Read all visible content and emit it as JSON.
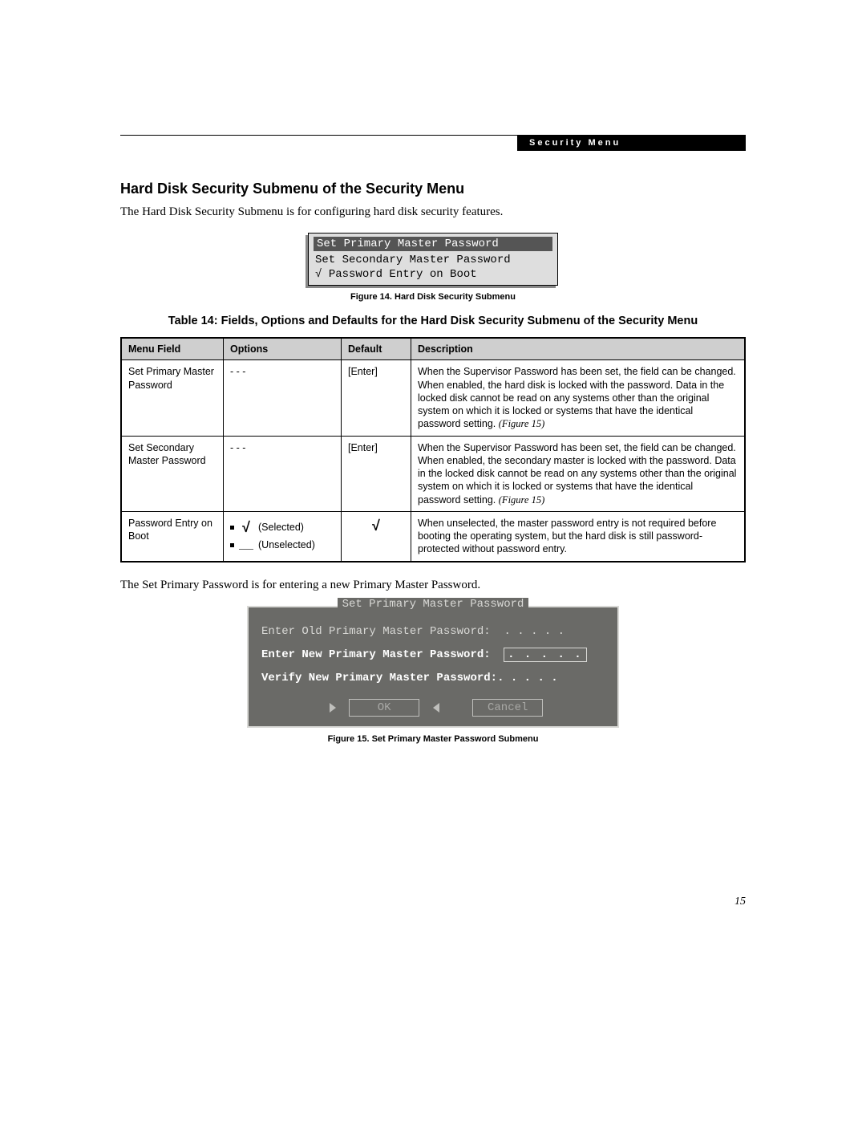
{
  "header_tag": "Security Menu",
  "section_title": "Hard Disk Security Submenu of the Security Menu",
  "intro_paragraph": "The Hard Disk Security Submenu is for configuring hard disk security features.",
  "fig14": {
    "rows": [
      "Set Primary Master Password",
      "Set Secondary Master Password",
      "Password Entry on Boot"
    ],
    "caption": "Figure 14.   Hard Disk Security Submenu"
  },
  "table": {
    "title": "Table 14: Fields, Options and Defaults for the Hard Disk Security Submenu of the Security Menu",
    "headers": {
      "c1": "Menu Field",
      "c2": "Options",
      "c3": "Default",
      "c4": "Description"
    },
    "rows": [
      {
        "field": "Set Primary Master Password",
        "options_text": "- - -",
        "default": "[Enter]",
        "description": "When the Supervisor Password has been set, the field can be changed. When enabled, the hard disk is locked with the password. Data in the locked disk cannot be read on any systems other than the original system on which it is locked or systems that have the identical password setting.",
        "figref": "(Figure 15)"
      },
      {
        "field": "Set Secondary Master Password",
        "options_text": "- - -",
        "default": "[Enter]",
        "description": "When the Supervisor Password has been set, the field can be changed. When enabled, the secondary master is locked with the password. Data in the locked disk cannot be read on any systems other than the original system on which it is locked or systems that have the identical password setting.",
        "figref": "(Figure 15)"
      },
      {
        "field": "Password Entry on Boot",
        "opt_selected": "(Selected)",
        "opt_unselected": "(Unselected)",
        "default_check": "√",
        "description": "When unselected, the master password entry is not required before booting the operating system, but the hard disk is still password-protected without password entry."
      }
    ]
  },
  "second_paragraph": "The Set Primary Password is for entering a new Primary Master Password.",
  "fig15": {
    "title": "Set Primary Master Password",
    "line_old": "Enter Old Primary Master Password:",
    "dots_old": ". . . . .",
    "line_new": "Enter New Primary Master Password:",
    "dots_new": ". . . . .",
    "line_verify": "Verify New Primary Master Password:",
    "dots_verify": ". . . . .",
    "btn_ok": "OK",
    "btn_cancel": "Cancel",
    "caption": "Figure 15.   Set Primary Master Password Submenu"
  },
  "page_number": "15"
}
